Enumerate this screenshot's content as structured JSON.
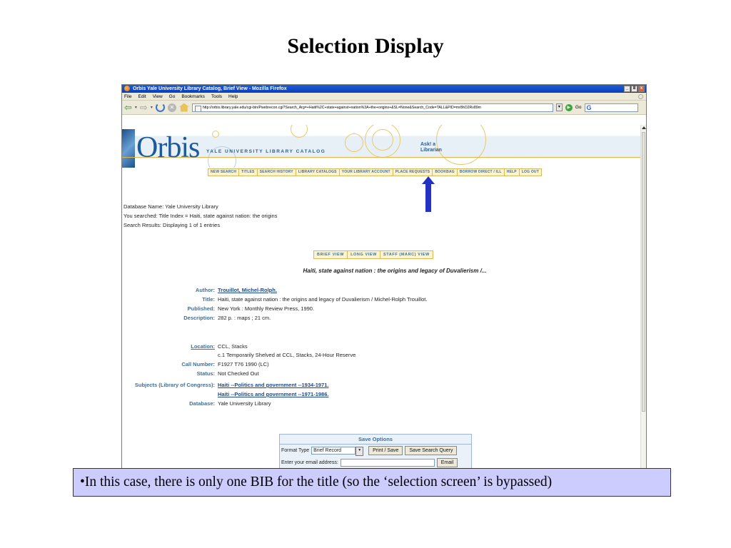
{
  "slide": {
    "title": "Selection Display",
    "note": "•In this case, there is only one BIB for the title (so the ‘selection screen’ is bypassed)"
  },
  "browser": {
    "window_title": "Orbis Yale University Library Catalog, Brief View - Mozilla Firefox",
    "window_buttons": [
      "_",
      "8",
      "x"
    ],
    "menu": [
      "File",
      "Edit",
      "View",
      "Go",
      "Bookmarks",
      "Tools",
      "Help"
    ],
    "url": "http://orbis.library.yale.edu/cgi-bin/Pwebrecon.cgi?Search_Arg=+Haiti%2C+state+against+nation%3A+the+origins+&SL=None&Search_Code=TALL&PID=mr8hO2Rv89m",
    "go_label": "Go",
    "search_engine": "G"
  },
  "banner": {
    "logo": "Orbis",
    "subtitle": "YALE UNIVERSITY LIBRARY CATALOG",
    "ask_line1": "Ask! a",
    "ask_line2": "Librarian"
  },
  "nav": [
    "NEW SEARCH",
    "TITLES",
    "SEARCH HISTORY",
    "LIBRARY CATALOGS",
    "YOUR LIBRARY ACCOUNT",
    "PLACE REQUESTS",
    "BOOKBAG",
    "BORROW DIRECT / ILL",
    "HELP",
    "LOG OUT"
  ],
  "search_info": {
    "database": "Database Name: Yale University Library",
    "searched": "You searched: Title Index = Haiti, state against nation: the origins",
    "results": "Search Results: Displaying 1 of 1 entries"
  },
  "views": [
    "BRIEF VIEW",
    "LONG VIEW",
    "STAFF (MARC) VIEW"
  ],
  "record": {
    "heading": "Haiti, state against nation : the origins and legacy of Duvalierism /...",
    "author_label": "Author:",
    "author": "Trouillot, Michel-Rolph.",
    "title_label": "Title:",
    "title": "Haiti, state against nation : the origins and legacy of Duvalierism / Michel-Rolph Trouillot.",
    "published_label": "Published:",
    "published": "New York : Monthly Review Press, 1990.",
    "description_label": "Description:",
    "description": "282 p. : maps ; 21 cm.",
    "location_label": "Location:",
    "location": "CCL, Stacks",
    "location_note": "c.1 Temporarily Shelved at CCL, Stacks, 24-Hour Reserve",
    "callnumber_label": "Call Number:",
    "callnumber": "F1927 T76 1990 (LC)",
    "status_label": "Status:",
    "status": "Not Checked Out",
    "subjects_label": "Subjects (Library of Congress):",
    "subject1": "Haiti --Politics and government --1934-1971.",
    "subject2": "Haiti --Politics and government --1971-1986.",
    "database_label": "Database:",
    "database": "Yale University Library"
  },
  "save": {
    "heading": "Save Options",
    "format_label": "Format Type",
    "format_value": "Brief Record",
    "print_button": "Print / Save",
    "save_query_button": "Save Search Query",
    "email_label": "Enter your email address:",
    "email_button": "Email"
  }
}
